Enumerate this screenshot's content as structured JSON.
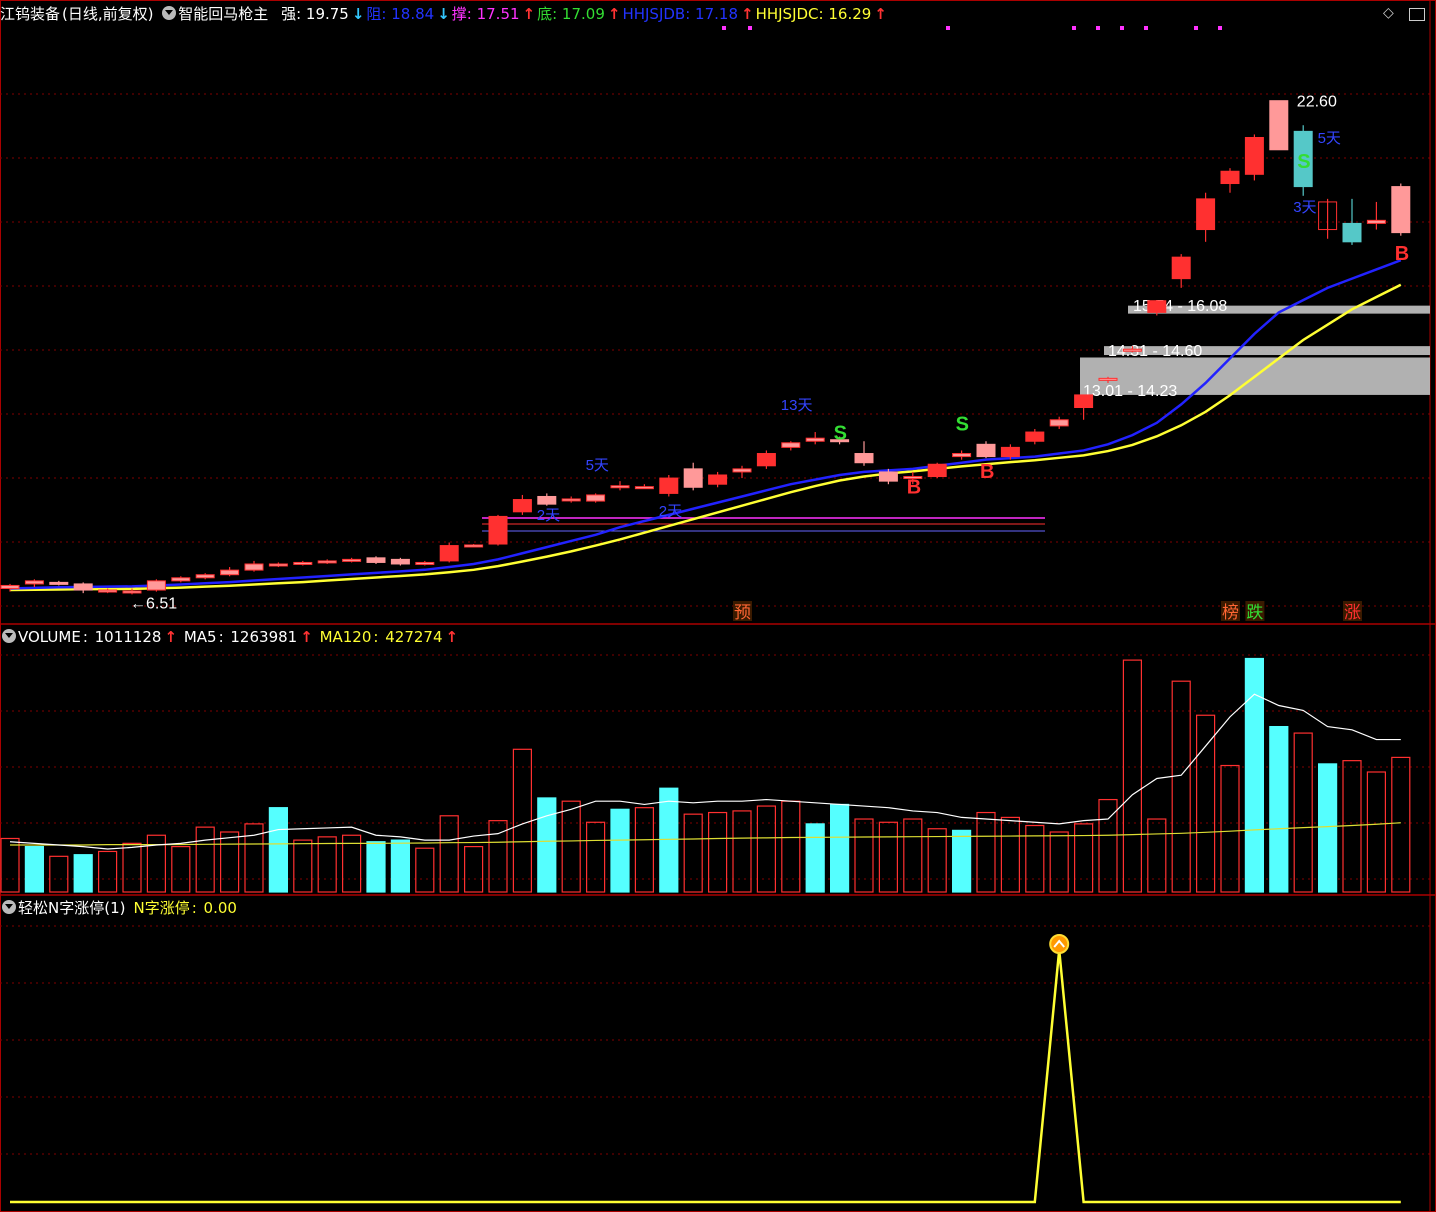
{
  "header": {
    "stock_name": "江钨装备",
    "period_label": "(日线,前复权)",
    "indicator_name": "智能回马枪主",
    "values": [
      {
        "label": "强",
        "value": "19.75",
        "arrow": "↓",
        "color": "#ffffff",
        "arrow_color": "#33c8ff"
      },
      {
        "label": "阻",
        "value": "18.84",
        "arrow": "↓",
        "color": "#2233ff",
        "arrow_color": "#33c8ff"
      },
      {
        "label": "撑",
        "value": "17.51",
        "arrow": "↑",
        "color": "#ff33ff",
        "arrow_color": "#ff3333"
      },
      {
        "label": "底",
        "value": "17.09",
        "arrow": "↑",
        "color": "#33dd33",
        "arrow_color": "#ff3333"
      },
      {
        "label": "HHJSJDB",
        "value": "17.18",
        "arrow": "↑",
        "color": "#2233ff",
        "arrow_color": "#ff3333"
      },
      {
        "label": "HHJSJDC",
        "value": "16.29",
        "arrow": "↑",
        "color": "#ffff33",
        "arrow_color": "#ff3333"
      }
    ]
  },
  "volume_header": {
    "name": "VOLUME",
    "value": "1011128",
    "ma5_label": "MA5",
    "ma5_value": "1263981",
    "ma120_label": "MA120",
    "ma120_value": "427274",
    "arrow": "↑"
  },
  "indicator_header": {
    "name": "轻松N字涨停(1)",
    "label": "N字涨停",
    "value": "0.00"
  },
  "window_icons": [
    "diamond-icon",
    "restore-icon"
  ],
  "colors": {
    "up": "#ff3030",
    "down": "#00ffff",
    "blue_line": "#2222ff",
    "yellow_line": "#ffff33",
    "grid": "#800000",
    "frame": "#aa0000",
    "support_band": "#c0c0c0"
  },
  "chart_data": {
    "type": "candlestick",
    "candles": [
      [
        6.7,
        6.85,
        6.6,
        6.8
      ],
      [
        6.85,
        7.0,
        6.75,
        6.95
      ],
      [
        6.9,
        6.95,
        6.8,
        6.85
      ],
      [
        6.85,
        6.9,
        6.55,
        6.65
      ],
      [
        6.6,
        6.7,
        6.55,
        6.65
      ],
      [
        6.6,
        6.7,
        6.51,
        6.62
      ],
      [
        6.65,
        7.0,
        6.6,
        6.95
      ],
      [
        6.95,
        7.1,
        6.9,
        7.05
      ],
      [
        7.05,
        7.2,
        7.0,
        7.15
      ],
      [
        7.15,
        7.4,
        7.1,
        7.3
      ],
      [
        7.3,
        7.6,
        7.25,
        7.5
      ],
      [
        7.45,
        7.55,
        7.4,
        7.5
      ],
      [
        7.5,
        7.6,
        7.45,
        7.55
      ],
      [
        7.55,
        7.65,
        7.5,
        7.6
      ],
      [
        7.6,
        7.7,
        7.55,
        7.65
      ],
      [
        7.7,
        7.75,
        7.5,
        7.55
      ],
      [
        7.65,
        7.7,
        7.45,
        7.5
      ],
      [
        7.5,
        7.6,
        7.45,
        7.55
      ],
      [
        7.6,
        8.2,
        7.55,
        8.1
      ],
      [
        8.1,
        8.15,
        8.05,
        8.12
      ],
      [
        8.15,
        9.1,
        8.1,
        9.05
      ],
      [
        9.2,
        9.75,
        9.1,
        9.6
      ],
      [
        9.7,
        9.8,
        9.4,
        9.45
      ],
      [
        9.6,
        9.7,
        9.5,
        9.62
      ],
      [
        9.55,
        9.8,
        9.5,
        9.75
      ],
      [
        10.0,
        10.2,
        9.9,
        10.05
      ],
      [
        10.0,
        10.1,
        9.95,
        10.02
      ],
      [
        9.8,
        10.4,
        9.7,
        10.3
      ],
      [
        10.6,
        10.8,
        9.9,
        10.0
      ],
      [
        10.1,
        10.5,
        10.0,
        10.4
      ],
      [
        10.5,
        10.7,
        10.3,
        10.6
      ],
      [
        10.7,
        11.2,
        10.6,
        11.1
      ],
      [
        11.3,
        11.5,
        11.2,
        11.45
      ],
      [
        11.5,
        11.8,
        11.4,
        11.6
      ],
      [
        11.55,
        11.65,
        11.4,
        11.5
      ],
      [
        11.1,
        11.5,
        10.7,
        10.8
      ],
      [
        10.5,
        10.6,
        10.1,
        10.2
      ],
      [
        10.3,
        10.5,
        10.1,
        10.35
      ],
      [
        10.35,
        10.8,
        10.3,
        10.75
      ],
      [
        11.0,
        11.2,
        10.9,
        11.1
      ],
      [
        11.4,
        11.5,
        10.95,
        11.0
      ],
      [
        11.0,
        11.4,
        10.9,
        11.3
      ],
      [
        11.5,
        11.9,
        11.4,
        11.8
      ],
      [
        12.0,
        12.3,
        11.9,
        12.2
      ],
      [
        12.6,
        13.01,
        12.2,
        13.01
      ],
      [
        13.5,
        13.6,
        13.4,
        13.55
      ],
      [
        14.5,
        14.6,
        14.4,
        14.5
      ],
      [
        15.7,
        16.1,
        15.6,
        16.08
      ],
      [
        16.8,
        17.6,
        16.5,
        17.5
      ],
      [
        18.4,
        19.6,
        18.0,
        19.4
      ],
      [
        19.9,
        20.4,
        19.6,
        20.3
      ],
      [
        20.2,
        21.5,
        20.0,
        21.4
      ],
      [
        22.6,
        22.6,
        21.0,
        21.0
      ],
      [
        21.6,
        21.8,
        19.5,
        19.8
      ],
      [
        18.4,
        19.4,
        18.1,
        19.3
      ],
      [
        18.6,
        19.4,
        17.9,
        18.0
      ],
      [
        18.6,
        19.3,
        18.4,
        18.7
      ],
      [
        19.8,
        19.9,
        18.2,
        18.3
      ]
    ],
    "ma_blue": [
      6.7,
      6.72,
      6.74,
      6.75,
      6.76,
      6.77,
      6.8,
      6.83,
      6.87,
      6.91,
      6.96,
      7.01,
      7.06,
      7.11,
      7.16,
      7.21,
      7.26,
      7.31,
      7.4,
      7.5,
      7.65,
      7.85,
      8.05,
      8.25,
      8.45,
      8.7,
      8.9,
      9.1,
      9.3,
      9.5,
      9.7,
      9.9,
      10.1,
      10.25,
      10.4,
      10.5,
      10.55,
      10.6,
      10.7,
      10.8,
      10.9,
      10.95,
      11.0,
      11.1,
      11.2,
      11.4,
      11.7,
      12.1,
      12.7,
      13.4,
      14.2,
      15.0,
      15.7,
      16.1,
      16.5,
      16.8,
      17.1,
      17.4
    ],
    "ma_yellow": [
      6.65,
      6.66,
      6.67,
      6.68,
      6.68,
      6.69,
      6.71,
      6.73,
      6.76,
      6.79,
      6.83,
      6.87,
      6.91,
      6.96,
      7.01,
      7.06,
      7.11,
      7.16,
      7.23,
      7.31,
      7.43,
      7.58,
      7.74,
      7.91,
      8.1,
      8.3,
      8.52,
      8.74,
      8.96,
      9.18,
      9.4,
      9.62,
      9.84,
      10.04,
      10.22,
      10.35,
      10.45,
      10.52,
      10.6,
      10.68,
      10.75,
      10.82,
      10.88,
      10.96,
      11.04,
      11.18,
      11.38,
      11.66,
      12.02,
      12.46,
      13.0,
      13.6,
      14.2,
      14.8,
      15.3,
      15.8,
      16.2,
      16.6
    ],
    "support_bands": [
      {
        "label": "15.74 - 16.08",
        "low": 15.74,
        "high": 15.92
      },
      {
        "label": "14.31 - 14.60",
        "low": 14.31,
        "high": 14.6
      },
      {
        "label": "13.01 - 14.23",
        "low": 13.01,
        "high": 14.23
      }
    ],
    "annotations": [
      {
        "text": "22.60",
        "index": 52,
        "value": 22.6
      },
      {
        "text": "6.51",
        "index": 5,
        "value": 6.51
      }
    ],
    "signals": [
      {
        "text": "S",
        "index": 34,
        "value": 11.55,
        "color": "#33dd33"
      },
      {
        "text": "S",
        "index": 39,
        "value": 11.85,
        "color": "#33dd33"
      },
      {
        "text": "S",
        "index": 53,
        "value": 20.4,
        "color": "#33dd33"
      },
      {
        "text": "B",
        "index": 37,
        "value": 9.8,
        "color": "#ff3030"
      },
      {
        "text": "B",
        "index": 40,
        "value": 10.3,
        "color": "#ff3030"
      },
      {
        "text": "B",
        "index": 57,
        "value": 17.4,
        "color": "#ff3030"
      }
    ],
    "day_labels": [
      {
        "text": "5天",
        "index": 24
      },
      {
        "text": "13天",
        "index": 32
      },
      {
        "text": "2天",
        "index": 22
      },
      {
        "text": "2天",
        "index": 27
      },
      {
        "text": "5天",
        "index": 54
      },
      {
        "text": "3天",
        "index": 53
      }
    ],
    "markers": [
      {
        "text": "预",
        "index": 30,
        "color": "#ff6633"
      },
      {
        "text": "榜",
        "index": 50,
        "color": "#ff6633"
      },
      {
        "text": "跌",
        "index": 51,
        "color": "#33dd33"
      },
      {
        "text": "涨",
        "index": 55,
        "color": "#ff3030"
      }
    ],
    "volume": [
      330,
      280,
      220,
      230,
      250,
      300,
      350,
      280,
      400,
      370,
      420,
      520,
      320,
      340,
      350,
      310,
      320,
      270,
      470,
      280,
      440,
      880,
      580,
      560,
      430,
      510,
      520,
      640,
      480,
      490,
      500,
      530,
      560,
      420,
      540,
      450,
      430,
      450,
      390,
      380,
      490,
      460,
      410,
      370,
      420,
      570,
      1430,
      450,
      1300,
      1090,
      780,
      1440,
      1020,
      980,
      790,
      810,
      740,
      830
    ],
    "volume_colors": [
      "u",
      "d",
      "u",
      "d",
      "u",
      "u",
      "u",
      "u",
      "u",
      "u",
      "u",
      "d",
      "u",
      "u",
      "u",
      "d",
      "d",
      "u",
      "u",
      "u",
      "u",
      "u",
      "d",
      "u",
      "u",
      "d",
      "u",
      "d",
      "u",
      "u",
      "u",
      "u",
      "u",
      "d",
      "d",
      "u",
      "u",
      "u",
      "u",
      "d",
      "u",
      "u",
      "u",
      "u",
      "u",
      "u",
      "u",
      "u",
      "u",
      "u",
      "u",
      "d",
      "d",
      "u",
      "d",
      "u",
      "u",
      "u"
    ],
    "vol_ma5": [
      310,
      300,
      290,
      280,
      265,
      275,
      290,
      300,
      320,
      335,
      350,
      385,
      390,
      395,
      400,
      350,
      340,
      320,
      320,
      345,
      360,
      420,
      470,
      510,
      560,
      560,
      540,
      560,
      550,
      560,
      560,
      570,
      560,
      550,
      540,
      530,
      520,
      500,
      490,
      460,
      450,
      440,
      430,
      420,
      440,
      450,
      600,
      700,
      720,
      900,
      1080,
      1220,
      1150,
      1120,
      1020,
      1000,
      940,
      940
    ],
    "vol_ma120": [
      290,
      290,
      290,
      290,
      292,
      292,
      292,
      293,
      294,
      295,
      296,
      297,
      298,
      299,
      300,
      300,
      301,
      302,
      304,
      305,
      307,
      310,
      313,
      315,
      318,
      320,
      322,
      325,
      327,
      330,
      332,
      334,
      336,
      337,
      338,
      339,
      340,
      341,
      342,
      343,
      344,
      345,
      346,
      347,
      348,
      350,
      354,
      358,
      362,
      368,
      375,
      383,
      390,
      397,
      403,
      410,
      418,
      427
    ],
    "n_limit_up": [
      0,
      0,
      0,
      0,
      0,
      0,
      0,
      0,
      0,
      0,
      0,
      0,
      0,
      0,
      0,
      0,
      0,
      0,
      0,
      0,
      0,
      0,
      0,
      0,
      0,
      0,
      0,
      0,
      0,
      0,
      0,
      0,
      0,
      0,
      0,
      0,
      0,
      0,
      0,
      0,
      0,
      0,
      0,
      1,
      0,
      0,
      0,
      0,
      0,
      0,
      0,
      0,
      0,
      0,
      0,
      0,
      0,
      0
    ],
    "price_range": [
      6.0,
      23.6
    ],
    "grid": true
  }
}
